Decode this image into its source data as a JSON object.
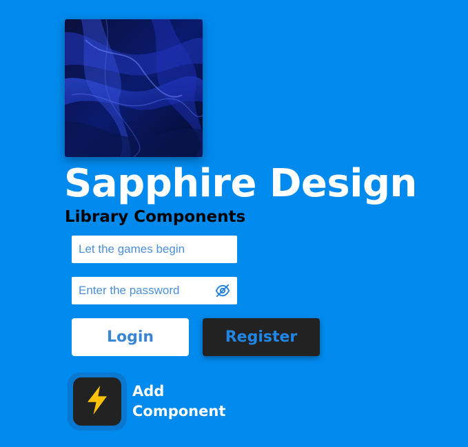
{
  "hero": {
    "title": "Sapphire Design",
    "subtitle": "Library Components"
  },
  "form": {
    "username_placeholder": "Let the games begin",
    "password_placeholder": "Enter the password",
    "password_toggle_icon": "eye-slash-icon"
  },
  "buttons": {
    "login_label": "Login",
    "register_label": "Register"
  },
  "add_component": {
    "label": "Add Component",
    "icon": "lightning-bolt-icon"
  },
  "colors": {
    "background": "#018AEE",
    "accent": "#1E87E8",
    "dark": "#222222",
    "bolt": "#FFC107"
  }
}
